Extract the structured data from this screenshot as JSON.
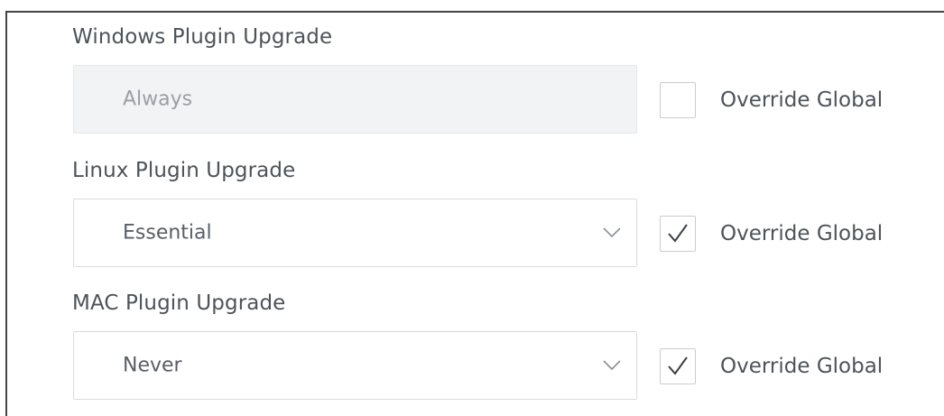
{
  "rows": [
    {
      "label": "Windows Plugin Upgrade",
      "value": "Always",
      "disabled": true,
      "has_dropdown": false,
      "override_checked": false,
      "override_label": "Override Global"
    },
    {
      "label": "Linux Plugin Upgrade",
      "value": "Essential",
      "disabled": false,
      "has_dropdown": true,
      "override_checked": true,
      "override_label": "Override Global"
    },
    {
      "label": "MAC Plugin Upgrade",
      "value": "Never",
      "disabled": false,
      "has_dropdown": true,
      "override_checked": true,
      "override_label": "Override Global"
    }
  ],
  "colors": {
    "frame_border": "#444444",
    "field_border": "#d9dbde",
    "disabled_fill": "#f2f3f4",
    "text": "#4d535a",
    "checkmark": "#3a3f45"
  }
}
